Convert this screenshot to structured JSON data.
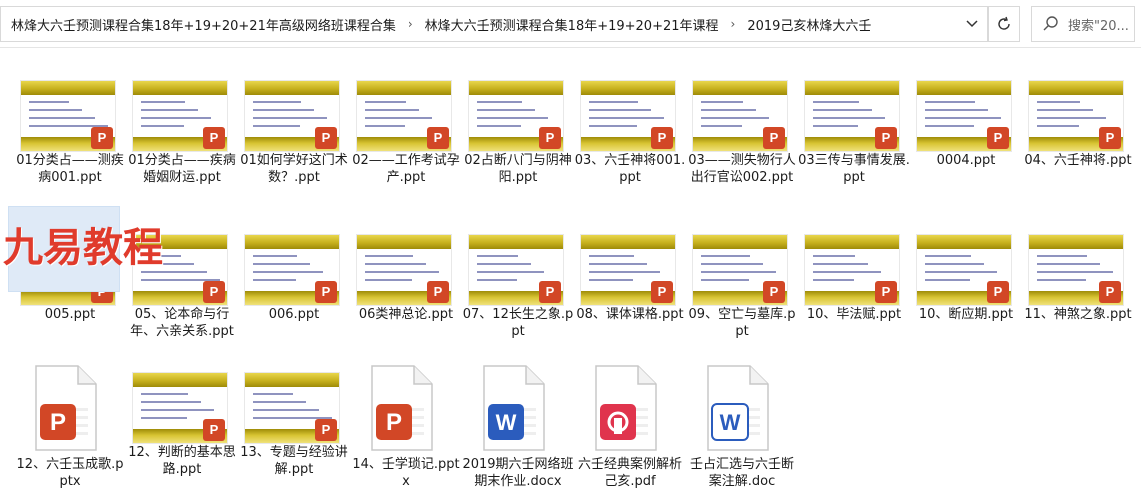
{
  "breadcrumb": {
    "items": [
      "林烽大六壬预测课程合集18年+19+20+21年高级网络班课程合集",
      "林烽大六壬预测课程合集18年+19+20+21年课程",
      "2019己亥林烽大六壬"
    ]
  },
  "search": {
    "placeholder": "搜索\"20..."
  },
  "watermark": "九易教程",
  "files": [
    {
      "name": "01分类占——测疾病001.ppt",
      "type": "ppt"
    },
    {
      "name": "01分类占——疾病婚姻财运.ppt",
      "type": "ppt"
    },
    {
      "name": "01如何学好这门术数？.ppt",
      "type": "ppt"
    },
    {
      "name": "02——工作考试孕产.ppt",
      "type": "ppt"
    },
    {
      "name": "02占断八门与阴神阳.ppt",
      "type": "ppt"
    },
    {
      "name": "03、六壬神将001.ppt",
      "type": "ppt"
    },
    {
      "name": "03——测失物行人出行官讼002.ppt",
      "type": "ppt"
    },
    {
      "name": "03三传与事情发展.ppt",
      "type": "ppt"
    },
    {
      "name": "0004.ppt",
      "type": "ppt"
    },
    {
      "name": "04、六壬神将.ppt",
      "type": "ppt"
    },
    {
      "name": "005.ppt",
      "type": "ppt"
    },
    {
      "name": "05、论本命与行年、六亲关系.ppt",
      "type": "ppt"
    },
    {
      "name": "006.ppt",
      "type": "ppt"
    },
    {
      "name": "06类神总论.ppt",
      "type": "ppt"
    },
    {
      "name": "07、12长生之象.ppt",
      "type": "ppt"
    },
    {
      "name": "08、课体课格.ppt",
      "type": "ppt"
    },
    {
      "name": "09、空亡与墓库.ppt",
      "type": "ppt"
    },
    {
      "name": "10、毕法赋.ppt",
      "type": "ppt"
    },
    {
      "name": "10、断应期.ppt",
      "type": "ppt"
    },
    {
      "name": "11、神煞之象.ppt",
      "type": "ppt"
    },
    {
      "name": "12、六壬玉成歌.pptx",
      "type": "pptx"
    },
    {
      "name": "12、判断的基本思路.ppt",
      "type": "ppt"
    },
    {
      "name": "13、专题与经验讲解.ppt",
      "type": "ppt"
    },
    {
      "name": "14、壬学琐记.pptx",
      "type": "pptx"
    },
    {
      "name": "2019期六壬网络班期末作业.docx",
      "type": "docx"
    },
    {
      "name": "六壬经典案例解析己亥.pdf",
      "type": "pdf"
    },
    {
      "name": "壬占汇选与六壬断案注解.doc",
      "type": "doc"
    }
  ],
  "icons": {
    "ppt_badge": "P",
    "word_badge": "W",
    "colors": {
      "ppt": "#d24726",
      "word": "#2b5cbd",
      "pdf": "#e0344d"
    }
  }
}
